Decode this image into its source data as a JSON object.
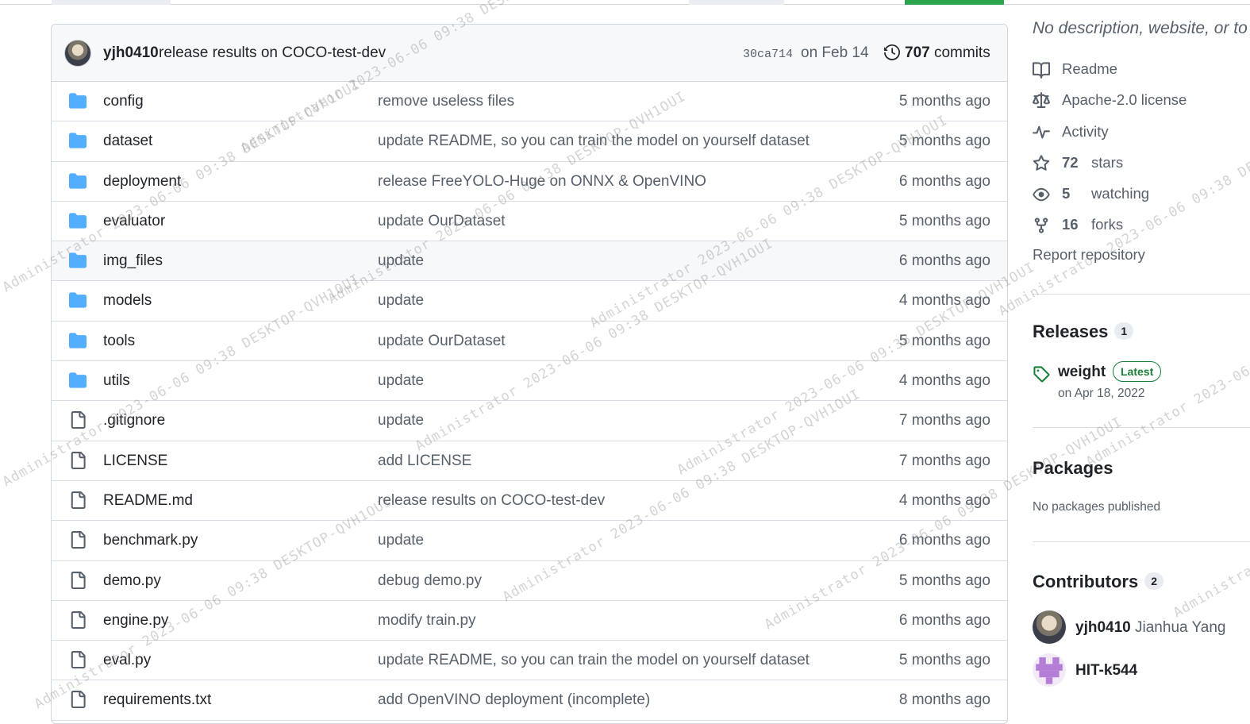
{
  "commit_bar": {
    "author": "yjh0410",
    "message": "release results on COCO-test-dev",
    "sha": "30ca714",
    "date": "on Feb 14",
    "commit_count": "707",
    "commit_label": "commits"
  },
  "files": [
    {
      "name": "config",
      "type": "dir",
      "message": "remove useless files",
      "age": "5 months ago"
    },
    {
      "name": "dataset",
      "type": "dir",
      "message": "update README, so you can train the model on yourself dataset",
      "age": "5 months ago"
    },
    {
      "name": "deployment",
      "type": "dir",
      "message": "release FreeYOLO-Huge on ONNX & OpenVINO",
      "age": "6 months ago"
    },
    {
      "name": "evaluator",
      "type": "dir",
      "message": "update OurDataset",
      "age": "5 months ago"
    },
    {
      "name": "img_files",
      "type": "dir",
      "message": "update",
      "age": "6 months ago"
    },
    {
      "name": "models",
      "type": "dir",
      "message": "update",
      "age": "4 months ago"
    },
    {
      "name": "tools",
      "type": "dir",
      "message": "update OurDataset",
      "age": "5 months ago"
    },
    {
      "name": "utils",
      "type": "dir",
      "message": "update",
      "age": "4 months ago"
    },
    {
      "name": ".gitignore",
      "type": "file",
      "message": "update",
      "age": "7 months ago"
    },
    {
      "name": "LICENSE",
      "type": "file",
      "message": "add LICENSE",
      "age": "7 months ago"
    },
    {
      "name": "README.md",
      "type": "file",
      "message": "release results on COCO-test-dev",
      "age": "4 months ago"
    },
    {
      "name": "benchmark.py",
      "type": "file",
      "message": "update",
      "age": "6 months ago"
    },
    {
      "name": "demo.py",
      "type": "file",
      "message": "debug demo.py",
      "age": "5 months ago"
    },
    {
      "name": "engine.py",
      "type": "file",
      "message": "modify train.py",
      "age": "6 months ago"
    },
    {
      "name": "eval.py",
      "type": "file",
      "message": "update README, so you can train the model on yourself dataset",
      "age": "5 months ago"
    },
    {
      "name": "requirements.txt",
      "type": "file",
      "message": "add OpenVINO deployment (incomplete)",
      "age": "8 months ago"
    }
  ],
  "sidebar": {
    "description": "No description, website, or to",
    "readme": "Readme",
    "license": "Apache-2.0 license",
    "activity": "Activity",
    "stars_count": "72",
    "stars_label": "stars",
    "watching_count": "5",
    "watching_label": "watching",
    "forks_count": "16",
    "forks_label": "forks",
    "report": "Report repository",
    "releases_title": "Releases",
    "releases_count": "1",
    "release_name": "weight",
    "release_badge": "Latest",
    "release_date": "on Apr 18, 2022",
    "packages_title": "Packages",
    "packages_empty": "No packages published",
    "contributors_title": "Contributors",
    "contributors_count": "2",
    "contributors": [
      {
        "login": "yjh0410",
        "name": "Jianhua Yang"
      },
      {
        "login": "HIT-k544",
        "name": ""
      }
    ]
  },
  "watermark": "Administrator 2023-06-06 09:38 DESKTOP-QVH1OUI",
  "colors": {
    "folder": "#54aeff",
    "link": "#0969da",
    "muted": "#57606a",
    "border": "#d0d7de",
    "release_green": "#1a7f37"
  }
}
